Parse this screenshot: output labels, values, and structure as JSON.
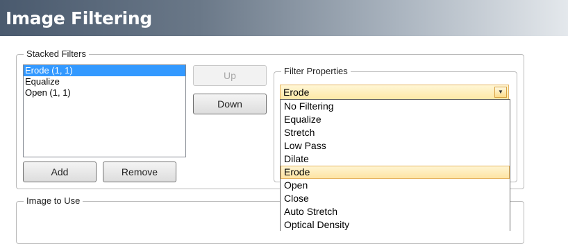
{
  "header": {
    "title": "Image Filtering"
  },
  "stacked_filters": {
    "legend": "Stacked Filters",
    "items": [
      "Erode (1, 1)",
      "Equalize",
      "Open (1, 1)"
    ],
    "selected_index": 0,
    "up_label": "Up",
    "down_label": "Down",
    "add_label": "Add",
    "remove_label": "Remove"
  },
  "filter_properties": {
    "legend": "Filter Properties",
    "selected": "Erode",
    "options": [
      "No Filtering",
      "Equalize",
      "Stretch",
      "Low Pass",
      "Dilate",
      "Erode",
      "Open",
      "Close",
      "Auto Stretch",
      "Optical Density"
    ],
    "selected_option_index": 5
  },
  "image_to_use": {
    "legend": "Image to Use"
  },
  "colors": {
    "list_selection": "#3399ff",
    "combo_highlight": "#fde8a6",
    "combo_border": "#e5b35f"
  }
}
